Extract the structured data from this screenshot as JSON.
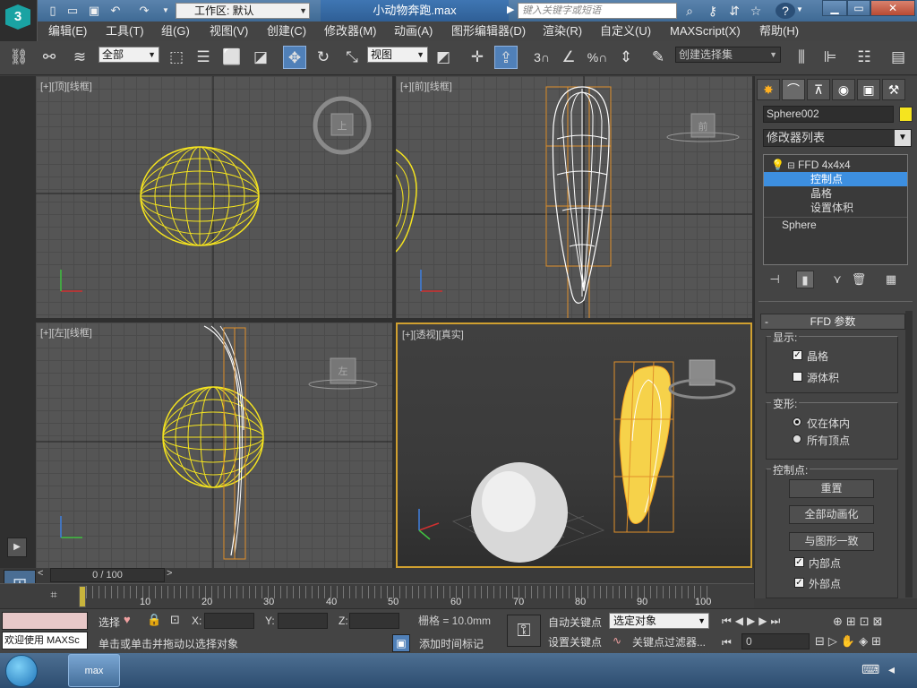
{
  "titlebar": {
    "workspace_label": "工作区: 默认",
    "document_title": "小动物奔跑.max",
    "search_placeholder": "键入关键字或短语",
    "help_icon": "?"
  },
  "menu": [
    "编辑(E)",
    "工具(T)",
    "组(G)",
    "视图(V)",
    "创建(C)",
    "修改器(M)",
    "动画(A)",
    "图形编辑器(D)",
    "渲染(R)",
    "自定义(U)",
    "MAXScript(X)",
    "帮助(H)"
  ],
  "toolbar": {
    "selection_filter": "全部",
    "ref_coord": "视图",
    "named_selection": "创建选择集",
    "snap_3": "3",
    "percent_snap": "%"
  },
  "viewports": {
    "top": "[+][顶][线框]",
    "front": "[+][前][线框]",
    "left": "[+][左][线框]",
    "perspective": "[+][透视][真实]",
    "viewcube_top": "上",
    "viewcube_front": "前",
    "viewcube_left": "左"
  },
  "command_panel": {
    "object_name": "Sphere002",
    "object_color": "#f5e41f",
    "modifier_list": "修改器列表",
    "stack": {
      "modifier": "FFD 4x4x4",
      "sub_control_points": "控制点",
      "sub_lattice": "晶格",
      "sub_set_volume": "设置体积",
      "base_object": "Sphere"
    },
    "rollout_title": "FFD 参数",
    "display_group": "显示:",
    "lattice": "晶格",
    "source_volume": "源体积",
    "deform_group": "变形:",
    "only_in_volume": "仅在体内",
    "all_vertices": "所有顶点",
    "control_points_group": "控制点:",
    "reset_button": "重置",
    "animate_all_button": "全部动画化",
    "conform_button": "与图形一致",
    "inside_points": "内部点",
    "outside_points": "外部点"
  },
  "timeline": {
    "frame_label": "0 / 100",
    "ticks": [
      "10",
      "20",
      "30",
      "40",
      "50",
      "60",
      "70",
      "80",
      "90",
      "100"
    ]
  },
  "status": {
    "maxscript_listener": "欢迎使用 MAXSc",
    "selection_label": "选择",
    "x_label": "X:",
    "y_label": "Y:",
    "z_label": "Z:",
    "grid": "栅格 = 10.0mm",
    "prompt": "单击或单击并拖动以选择对象",
    "add_time_tag": "添加时间标记",
    "auto_key": "自动关键点",
    "set_key": "设置关键点",
    "key_mode": "选定对象",
    "key_filters": "关键点过滤器...",
    "current_frame": "0"
  },
  "taskbar": {
    "app_label": "max"
  }
}
